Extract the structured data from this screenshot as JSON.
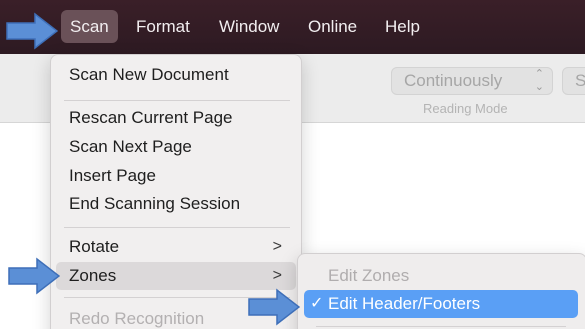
{
  "menubar": {
    "items": [
      {
        "label": "Scan"
      },
      {
        "label": "Format"
      },
      {
        "label": "Window"
      },
      {
        "label": "Online"
      },
      {
        "label": "Help"
      }
    ]
  },
  "toolbar": {
    "reading_mode_value": "Continuously",
    "reading_mode_caption": "Reading Mode",
    "next_button_partial": "S"
  },
  "scan_menu": {
    "items": [
      {
        "label": "Scan New Document"
      },
      {
        "label": "Rescan Current Page"
      },
      {
        "label": "Scan Next Page"
      },
      {
        "label": "Insert Page"
      },
      {
        "label": "End Scanning Session"
      },
      {
        "label": "Rotate"
      },
      {
        "label": "Zones"
      },
      {
        "label": "Redo Recognition"
      }
    ]
  },
  "zones_submenu": {
    "items": [
      {
        "label": "Edit Zones"
      },
      {
        "label": "Edit Header/Footers",
        "checkmark": "✓"
      }
    ]
  },
  "colors": {
    "menubar_bg": "#2d1a22",
    "selection_blue": "#5a9ff5",
    "annotation_arrow": "#5b8fd6"
  }
}
